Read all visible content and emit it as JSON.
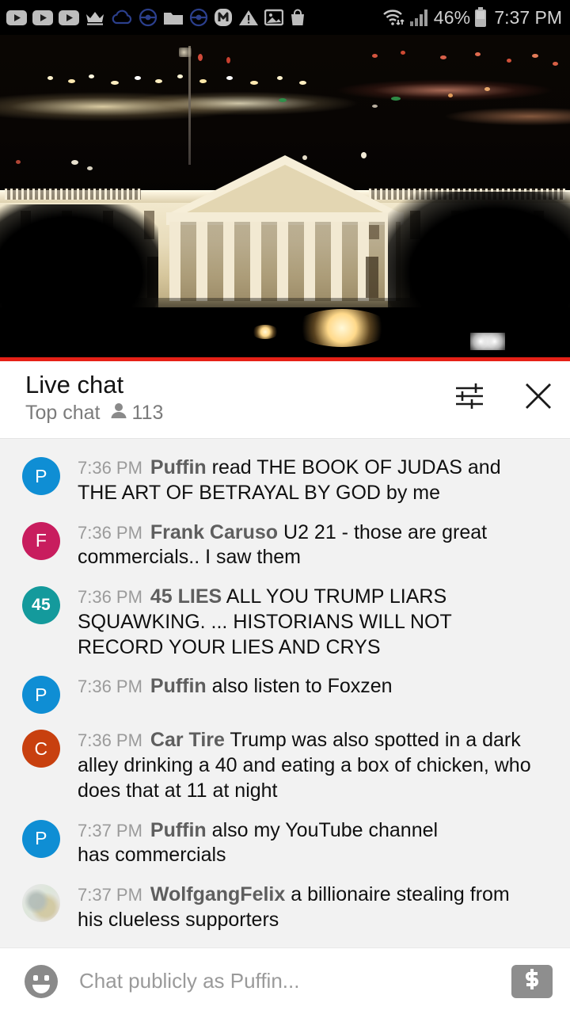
{
  "status_bar": {
    "icons": [
      {
        "name": "youtube-icon-1",
        "glyph": "youtube"
      },
      {
        "name": "youtube-icon-2",
        "glyph": "youtube"
      },
      {
        "name": "youtube-icon-3",
        "glyph": "youtube"
      },
      {
        "name": "crown-icon",
        "glyph": "crown"
      },
      {
        "name": "cloud-icon",
        "glyph": "cloud"
      },
      {
        "name": "pokeball-icon-1",
        "glyph": "pokeball"
      },
      {
        "name": "folder-icon",
        "glyph": "folder"
      },
      {
        "name": "pokeball-icon-2",
        "glyph": "pokeball"
      },
      {
        "name": "m-badge-icon",
        "glyph": "m-badge"
      },
      {
        "name": "warning-icon",
        "glyph": "warning"
      },
      {
        "name": "image-icon",
        "glyph": "image"
      },
      {
        "name": "shopping-bag-icon",
        "glyph": "bag"
      }
    ],
    "wifi_label": "wifi-icon",
    "signal_label": "signal-icon",
    "battery_percent": "46%",
    "battery_label": "battery-icon",
    "time": "7:37 PM"
  },
  "video": {
    "description": "White House at night live stream",
    "progress_color": "#e62117",
    "progress_percent": 100
  },
  "chat_header": {
    "title": "Live chat",
    "mode": "Top chat",
    "viewer_count": "113",
    "settings_icon": "chat-settings-icon",
    "close_icon": "close-icon"
  },
  "messages": [
    {
      "avatar_letter": "P",
      "avatar_color": "#0f8ed4",
      "avatar_type": "letter",
      "time": "7:36 PM",
      "author": "Puffin",
      "text": "read THE BOOK OF JUDAS and THE ART OF BETRAYAL BY GOD by me"
    },
    {
      "avatar_letter": "F",
      "avatar_color": "#c81d5e",
      "avatar_type": "letter",
      "time": "7:36 PM",
      "author": "Frank Caruso",
      "text": "U2 21 - those are great commercials.. I saw them"
    },
    {
      "avatar_letter": "45",
      "avatar_color": "#149a9c",
      "avatar_type": "letter",
      "time": "7:36 PM",
      "author": "45 LIES",
      "text": "ALL YOU TRUMP LIARS SQUAWKING. ... HISTORIANS WILL NOT RECORD YOUR LIES AND CRYS"
    },
    {
      "avatar_letter": "P",
      "avatar_color": "#0f8ed4",
      "avatar_type": "letter",
      "time": "7:36 PM",
      "author": "Puffin",
      "text": "also listen to Foxzen"
    },
    {
      "avatar_letter": "C",
      "avatar_color": "#c8400f",
      "avatar_type": "letter",
      "time": "7:36 PM",
      "author": "Car Tire",
      "text": "Trump was also spotted in a dark alley drinking a 40 and eating a box of chicken, who does that at 11 at night"
    },
    {
      "avatar_letter": "P",
      "avatar_color": "#0f8ed4",
      "avatar_type": "letter",
      "time": "7:37 PM",
      "author": "Puffin",
      "text": "also my YouTube channel has commercials"
    },
    {
      "avatar_letter": "",
      "avatar_color": "#e4e6e2",
      "avatar_type": "photo",
      "time": "7:37 PM",
      "author": "WolfgangFelix",
      "text": "a billionaire stealing from his clueless supporters"
    }
  ],
  "input_bar": {
    "emoji_icon": "emoji-icon",
    "placeholder": "Chat publicly as Puffin...",
    "superchat_icon": "dollar-icon",
    "value": ""
  }
}
